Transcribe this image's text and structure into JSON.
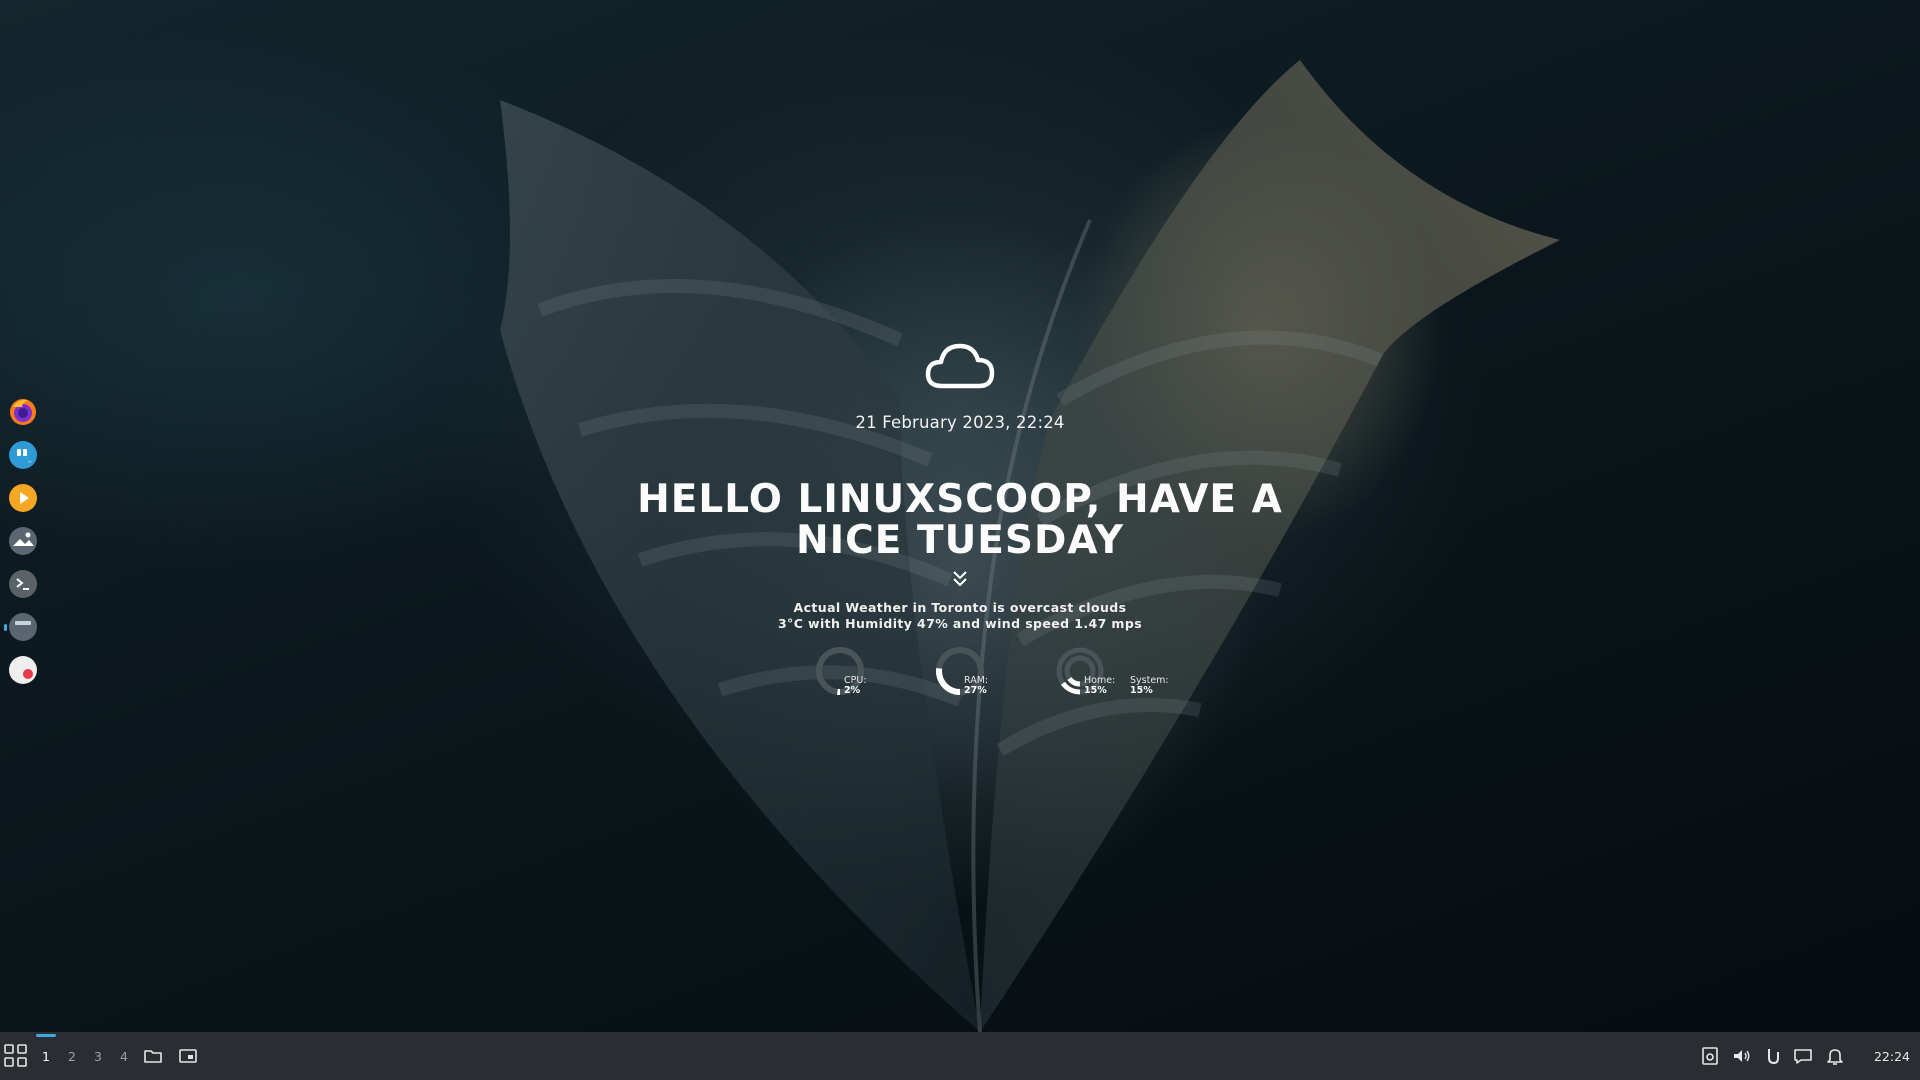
{
  "desktop": {
    "datetime": "21 February 2023, 22:24",
    "greeting_line1": "Hello LinuxScoop, have a",
    "greeting_line2": "nice Tuesday",
    "weather_line1": "Actual Weather in Toronto is overcast clouds",
    "weather_line2": "3°C with Humidity 47% and wind speed 1.47 mps",
    "weather_icon": "cloud-icon",
    "gauges": {
      "cpu": {
        "label": "CPU:",
        "value": "2%",
        "fraction": 0.02
      },
      "ram": {
        "label": "RAM:",
        "value": "27%",
        "fraction": 0.27
      },
      "home": {
        "label": "Home:",
        "value": "15%",
        "fraction": 0.15
      },
      "system": {
        "label": "System:",
        "value": "15%",
        "fraction": 0.15
      }
    }
  },
  "dock": {
    "items": [
      {
        "name": "firefox",
        "icon": "firefox-icon"
      },
      {
        "name": "quote-app",
        "icon": "quote-icon"
      },
      {
        "name": "media-player",
        "icon": "play-icon"
      },
      {
        "name": "image-viewer",
        "icon": "image-icon"
      },
      {
        "name": "terminal",
        "icon": "terminal-icon"
      },
      {
        "name": "file-manager",
        "icon": "drive-icon"
      },
      {
        "name": "screen-recorder",
        "icon": "record-icon"
      }
    ]
  },
  "taskbar": {
    "workspaces": [
      "1",
      "2",
      "3",
      "4"
    ],
    "active_workspace": "1",
    "clock": "22:24"
  },
  "colors": {
    "accent": "#3fa9e0",
    "taskbar_bg": "#2a2d31",
    "gauge_track": "#4a5458",
    "gauge_fill": "#ffffff"
  }
}
